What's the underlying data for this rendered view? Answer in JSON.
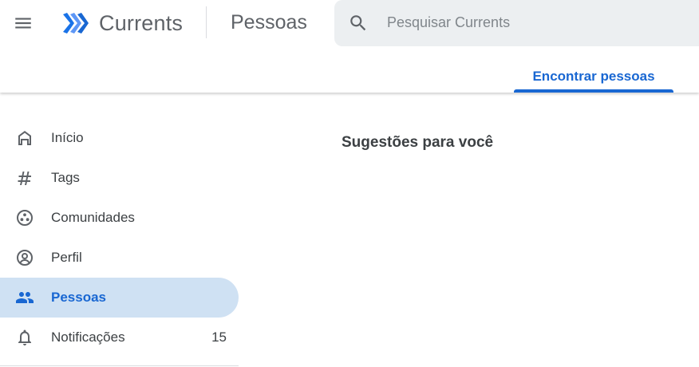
{
  "header": {
    "app_name": "Currents",
    "page_title": "Pessoas",
    "search": {
      "placeholder": "Pesquisar Currents",
      "value": ""
    },
    "icons": {
      "menu": "menu-icon",
      "logo": "currents-logo",
      "search": "search-icon"
    }
  },
  "tabs": [
    {
      "label": "Encontrar pessoas",
      "active": true
    }
  ],
  "sidebar": {
    "items": [
      {
        "label": "Início",
        "icon": "home-icon",
        "active": false
      },
      {
        "label": "Tags",
        "icon": "hashtag-icon",
        "active": false
      },
      {
        "label": "Comunidades",
        "icon": "communities-icon",
        "active": false
      },
      {
        "label": "Perfil",
        "icon": "profile-icon",
        "active": false
      },
      {
        "label": "Pessoas",
        "icon": "people-icon",
        "active": true
      },
      {
        "label": "Notificações",
        "icon": "bell-icon",
        "active": false,
        "count": "15"
      }
    ]
  },
  "main": {
    "section_title": "Sugestões para você"
  },
  "colors": {
    "accent": "#1967d2",
    "active_nav_bg": "#cfe1f3",
    "search_bg": "#eceff1",
    "text": "#3c4043"
  }
}
